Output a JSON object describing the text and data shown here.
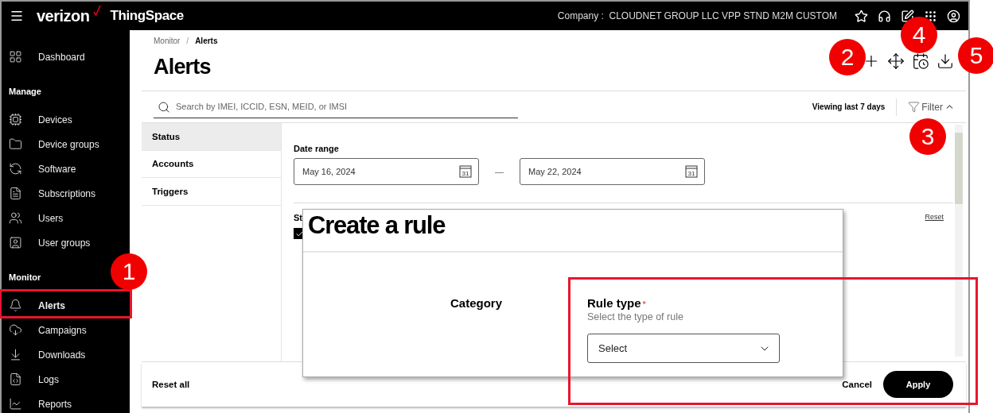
{
  "top_bar": {
    "brand": "verizon",
    "product": "ThingSpace",
    "company_label": "Company :",
    "company": "CLOUDNET GROUP LLC VPP STND M2M CUSTOM"
  },
  "sidebar": {
    "sections": [
      {
        "items": [
          {
            "label": "Dashboard",
            "selected": false
          }
        ]
      },
      {
        "title": "Manage",
        "items": [
          {
            "label": "Devices",
            "selected": false
          },
          {
            "label": "Device groups",
            "selected": false
          },
          {
            "label": "Software",
            "selected": false
          },
          {
            "label": "Subscriptions",
            "selected": false
          },
          {
            "label": "Users",
            "selected": false
          },
          {
            "label": "User groups",
            "selected": false
          }
        ]
      },
      {
        "title": "Monitor",
        "items": [
          {
            "label": "Alerts",
            "selected": true
          },
          {
            "label": "Campaigns",
            "selected": false
          },
          {
            "label": "Downloads",
            "selected": false
          },
          {
            "label": "Logs",
            "selected": false
          },
          {
            "label": "Reports",
            "selected": false
          }
        ]
      }
    ]
  },
  "breadcrumb": [
    "Monitor",
    "Alerts"
  ],
  "breadcrumb_separator": "/",
  "page_title": "Alerts",
  "search": {
    "placeholder": "Search by IMEI, ICCID, ESN, MEID, or IMSI"
  },
  "viewing": "Viewing last 7 days",
  "filter": {
    "label": "Filter",
    "expanded": true
  },
  "filter_tabs": [
    {
      "label": "Status",
      "selected": true
    },
    {
      "label": "Accounts",
      "selected": false
    },
    {
      "label": "Triggers",
      "selected": false
    }
  ],
  "date_range": {
    "label": "Date range",
    "from": "May 16, 2024",
    "to": "May 22, 2024",
    "separator": "—",
    "from_calendar_day": "31",
    "to_calendar_day": "31"
  },
  "status": {
    "label": "St",
    "checked": true,
    "reset": "Reset"
  },
  "footer": {
    "reset_all": "Reset all",
    "cancel": "Cancel",
    "apply": "Apply"
  },
  "dialog": {
    "title": "Create a rule",
    "category": "Category",
    "rule_type": {
      "label": "Rule type",
      "required": true,
      "required_mark": "*",
      "hint": "Select the type of rule",
      "placeholder": "Select"
    }
  },
  "markers": [
    {
      "label": "1"
    },
    {
      "label": "2"
    },
    {
      "label": "3"
    },
    {
      "label": "4"
    },
    {
      "label": "5"
    }
  ]
}
